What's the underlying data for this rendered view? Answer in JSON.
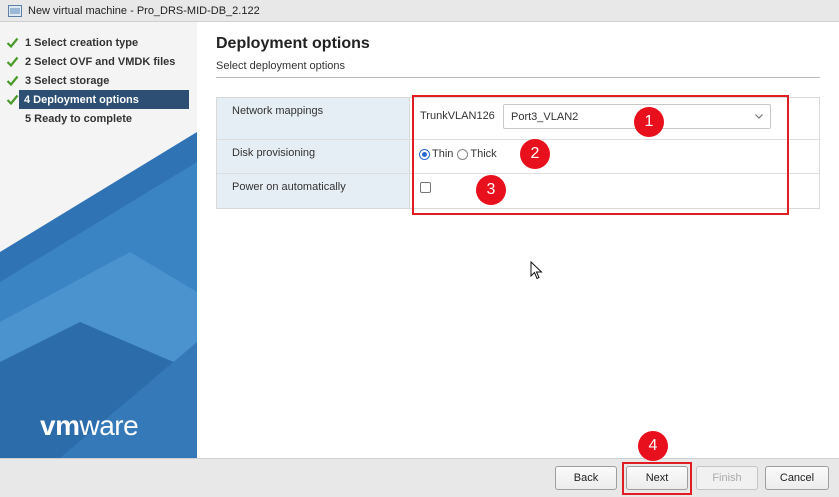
{
  "window": {
    "title": "New virtual machine - Pro_DRS-MID-DB_2.122"
  },
  "steps": [
    {
      "label": "1 Select creation type",
      "status": "done"
    },
    {
      "label": "2 Select OVF and VMDK files",
      "status": "done"
    },
    {
      "label": "3 Select storage",
      "status": "done"
    },
    {
      "label": "4 Deployment options",
      "status": "active"
    },
    {
      "label": "5 Ready to complete",
      "status": "pending"
    }
  ],
  "brand": {
    "logo_prefix": "vm",
    "logo_suffix": "ware"
  },
  "main": {
    "title": "Deployment options",
    "subtitle": "Select deployment options",
    "options": {
      "network_mappings": {
        "label": "Network mappings",
        "source_network": "TrunkVLAN126",
        "selected_port_group": "Port3_VLAN2"
      },
      "disk_provisioning": {
        "label": "Disk provisioning",
        "choices": [
          "Thin",
          "Thick"
        ],
        "selected": "Thin"
      },
      "power_on": {
        "label": "Power on automatically",
        "checked": false
      }
    }
  },
  "annotations": {
    "badge_1": "1",
    "badge_2": "2",
    "badge_3": "3",
    "badge_4": "4"
  },
  "footer": {
    "back_label": "Back",
    "next_label": "Next",
    "finish_label": "Finish",
    "cancel_label": "Cancel",
    "finish_enabled": false
  },
  "colors": {
    "active_step_bg": "#2c4f73",
    "label_cell_bg": "#e6eef5",
    "highlight_red": "#e21c23",
    "badge_red": "#e8101c",
    "check_green": "#4a9a2a",
    "radio_blue": "#2a6ad1"
  },
  "icons": {
    "window_icon": "vm-window-icon",
    "step_done": "check-icon",
    "dropdown": "chevron-down-icon",
    "pointer": "mouse-cursor-icon"
  }
}
